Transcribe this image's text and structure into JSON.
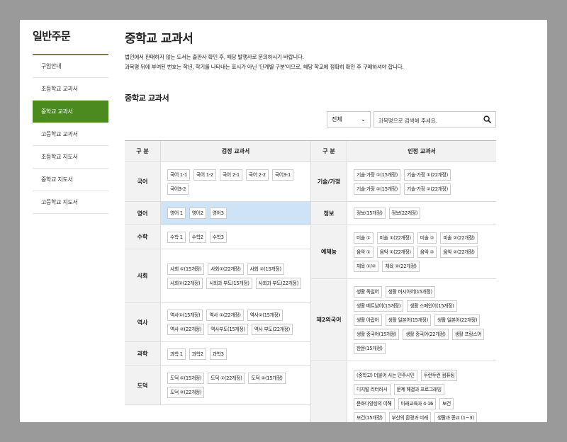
{
  "sidebar": {
    "title": "일반주문",
    "items": [
      {
        "label": "구입안내",
        "active": false
      },
      {
        "label": "초등학교 교과서",
        "active": false
      },
      {
        "label": "중학교 교과서",
        "active": true
      },
      {
        "label": "고등학교 교과서",
        "active": false
      },
      {
        "label": "초등학교 지도서",
        "active": false
      },
      {
        "label": "중학교 지도서",
        "active": false
      },
      {
        "label": "고등학교 지도서",
        "active": false
      }
    ]
  },
  "main": {
    "title": "중학교 교과서",
    "notice_line1": "법인에서 판매하지 않는 도서는 출판사 확인 후, 해당 발행사로 문의하시기 바랍니다.",
    "notice_line2": "과목명 뒤에 부여된 번호는 학년, 학기를 나타내는 표시가 아닌 '단계별 구분'이므로, 해당 학교에 정확히 확인 후 구매하셔야 합니다.",
    "section_title": "중학교 교과서",
    "filter_selected": "전체",
    "search_placeholder": "과목명으로 검색해 주세요."
  },
  "table": {
    "left_header": {
      "gubun": "구 분",
      "title": "검정 교과서"
    },
    "right_header": {
      "gubun": "구 분",
      "title": "인정 교과서"
    },
    "left_rows": [
      {
        "label": "국어",
        "h": 56,
        "items": [
          "국어 1-1",
          "국어 1-2",
          "국어 2-1",
          "국어 2-2",
          "국어3-1",
          "국어3-2"
        ]
      },
      {
        "label": "영어",
        "h": 33,
        "highlight": true,
        "items": [
          "영어 1",
          "영어2",
          "영어3"
        ]
      },
      {
        "label": "수학",
        "h": 34,
        "items": [
          "수학 1",
          "수학2",
          "수학3"
        ]
      },
      {
        "label": "사회",
        "h": 76,
        "items": [
          "사회 ①(15개정)",
          "사회①(22개정)",
          "사회 ②(15개정)",
          "사회②(22개정)",
          "사회과 부도(15개정)",
          "사회과 부도(22개정)"
        ]
      },
      {
        "label": "역사",
        "h": 55,
        "items": [
          "역사①(15개정)",
          "역사 ①(22개정)",
          "역사②(15개정)",
          "역사 ②(22개정)",
          "역사부도(15개정)",
          "역사 부도(22개정)"
        ]
      },
      {
        "label": "과학",
        "h": 34,
        "items": [
          "과학 1",
          "과학2",
          "과학3"
        ]
      },
      {
        "label": "도덕",
        "h": 55,
        "items": [
          "도덕 ①(15개정)",
          "도덕 ①(22개정)",
          "도덕 ②(15개정)",
          "도덕 ②(22개정)"
        ]
      }
    ],
    "right_rows": [
      {
        "label": "기술/가정",
        "h": 56,
        "items": [
          "기술·가정 ①(15개정)",
          "기술·가정 ①(22개정)",
          "기술·가정 ②(15개정)",
          "기술·가정 ②(22개정)"
        ]
      },
      {
        "label": "정보",
        "h": 33,
        "items": [
          "정보(15개정)",
          "정보(22개정)"
        ]
      },
      {
        "label": "예체능",
        "h": 76,
        "items": [
          "미술 ①",
          "미술 ①(22개정)",
          "미술 ②",
          "미술 ②(22개정)",
          "음악 ①",
          "음악 ①(22개정)",
          "음악 ②",
          "음악 ②(22개정)",
          "체육 ①/②",
          "체육 ②(22개정)"
        ]
      },
      {
        "label": "제2외국어",
        "h": 116,
        "items": [
          "생활 독일어",
          "생활 러시아어(15개정)",
          "생활 베트남어(15개정)",
          "생활 스페인어(15개정)",
          "생활 아랍어",
          "생활 일본어(15개정)",
          "생활 일본어(22개정)",
          "생활 중국어(15개정)",
          "생활 중국어(22개정)",
          "생활 프랑스어",
          "한문(15개정)"
        ]
      },
      {
        "label": "",
        "h": 100,
        "items": [
          "(중학교) 더불어 사는 민주시민",
          "두런두런 컴퓨팅",
          "디지털 리터러시",
          "문제 해결과 프로그래밍",
          "문화다양성의 이해",
          "미래교육과 4·16",
          "보건",
          "보건(15개정)",
          "부산의 환경과 미래",
          "생활과 종교 (1~3)"
        ]
      }
    ]
  }
}
